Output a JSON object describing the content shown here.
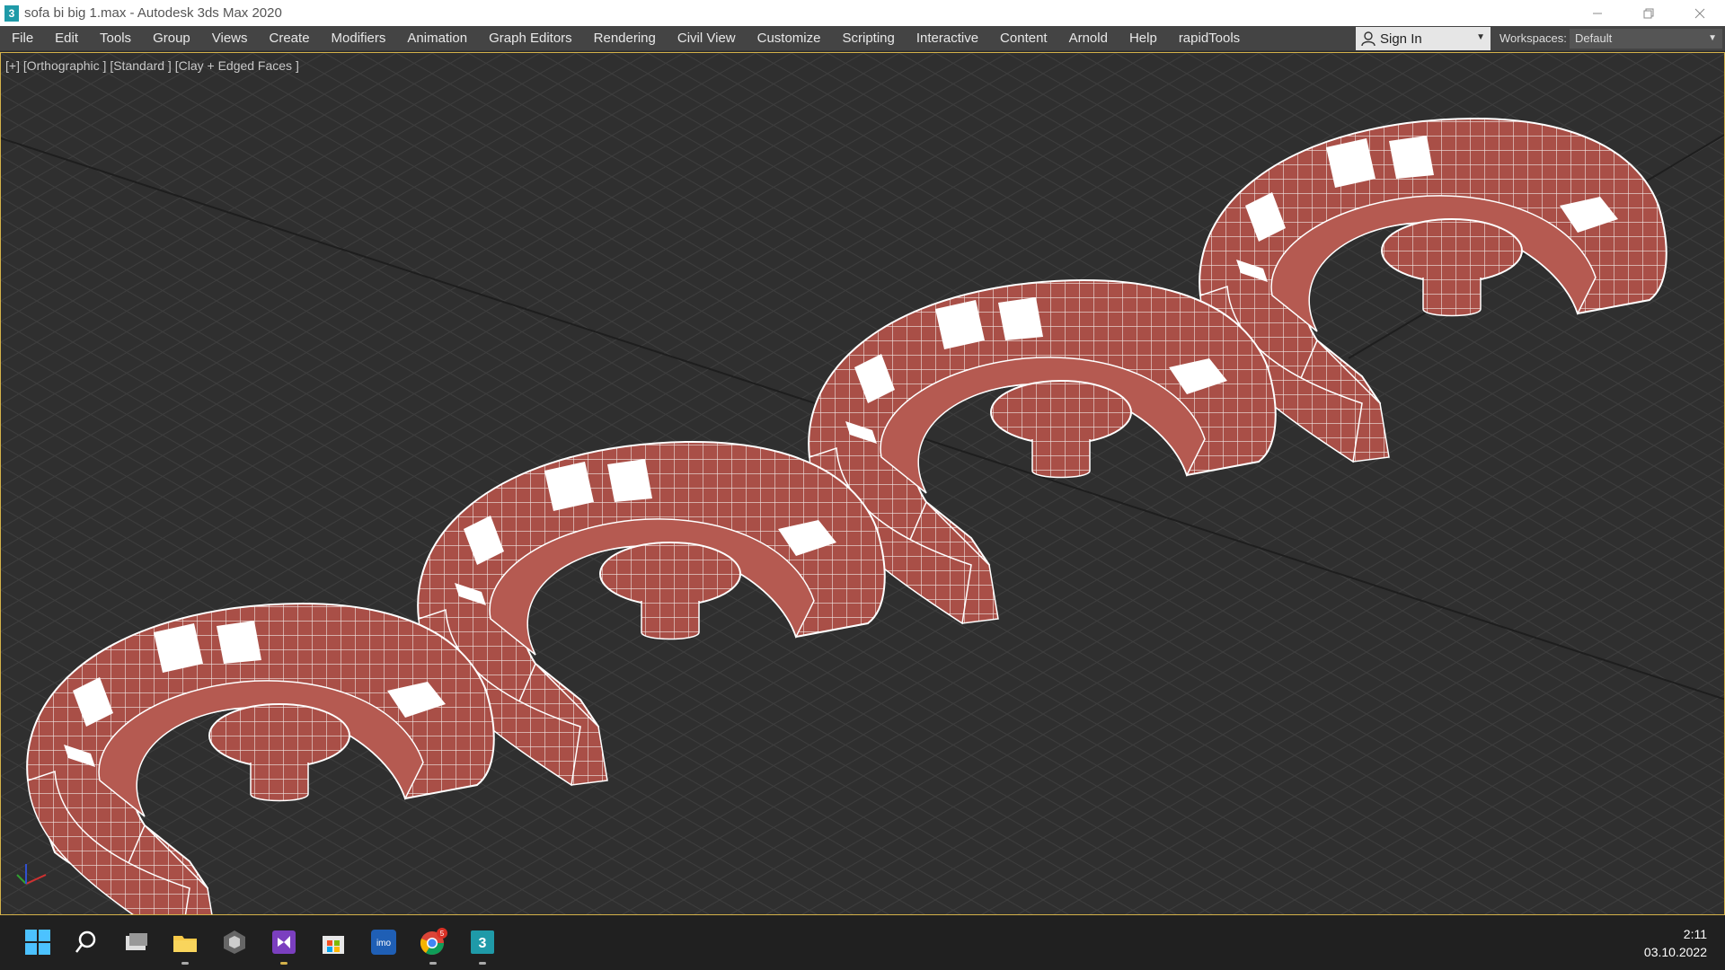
{
  "window": {
    "app_icon_letter": "3",
    "title": "sofa bi big 1.max - Autodesk 3ds Max 2020",
    "minimize_icon": "minimize-icon",
    "restore_icon": "restore-icon",
    "close_icon": "close-icon"
  },
  "menu": {
    "items": [
      "File",
      "Edit",
      "Tools",
      "Group",
      "Views",
      "Create",
      "Modifiers",
      "Animation",
      "Graph Editors",
      "Rendering",
      "Civil View",
      "Customize",
      "Scripting",
      "Interactive",
      "Content",
      "Arnold",
      "Help",
      "rapidTools"
    ],
    "signin_label": "Sign In",
    "workspaces_label": "Workspaces:",
    "workspace_value": "Default"
  },
  "viewport": {
    "label": "[+] [Orthographic ] [Standard ] [Clay + Edged Faces ]",
    "colors": {
      "background": "#2f2f2f",
      "grid": "#3d3d3d",
      "sofa": "#a94f47",
      "wire": "#ffffff",
      "pillow": "#ffffff",
      "border": "#d4b24a"
    }
  },
  "taskbar": {
    "icons": [
      "windows-start-icon",
      "search-icon",
      "task-view-icon",
      "file-explorer-icon",
      "unity-icon",
      "visual-studio-icon",
      "microsoft-store-icon",
      "imo-icon",
      "chrome-icon",
      "3dsmax-icon"
    ],
    "imo_label": "imo",
    "chrome_badge": "5",
    "max_label": "3",
    "time": "2:11",
    "date": "03.10.2022"
  }
}
